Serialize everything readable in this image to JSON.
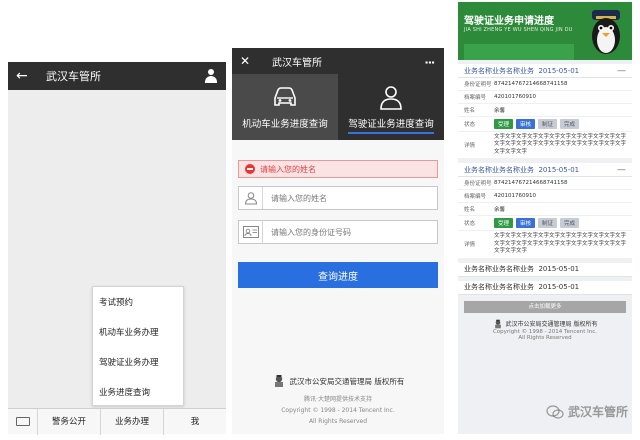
{
  "panel1": {
    "title": "武汉车管所",
    "back_icon": "back-arrow-icon",
    "user_icon": "person-icon",
    "menu": [
      "考试预约",
      "机动车业务办理",
      "驾驶证业务办理",
      "业务进度查询"
    ],
    "bottom_tabs": [
      "警务公开",
      "业务办理",
      "我"
    ]
  },
  "panel2": {
    "title": "武汉车管所",
    "close_glyph": "✕",
    "more_glyph": "•••",
    "tabs": [
      {
        "label": "机动车业务进度查询",
        "icon": "car-icon"
      },
      {
        "label": "驾驶证业务进度查询",
        "icon": "person-outline-icon"
      }
    ],
    "error": "请输入您的姓名",
    "name_placeholder": "请输入您的姓名",
    "id_placeholder": "请输入您的身份证号码",
    "submit": "查询进度",
    "footer": {
      "org": "武汉市公安局交通管理局 版权所有",
      "line1": "腾讯·大楚网提供技术支持",
      "line2": "Copyright © 1998 - 2014 Tencent Inc.",
      "line3": "All Rights Reserved"
    }
  },
  "panel3": {
    "banner_title": "驾驶证业务申请进度",
    "banner_sub": "JIA SHI ZHENG YE WU SHEN QING JIN DU",
    "cards": [
      {
        "title": "业务名称业务名称业务",
        "date": "2015-05-01",
        "id_label": "身份证明号",
        "id_value": "874214767214668741158",
        "file_label": "档案编号",
        "file_value": "420101760910",
        "name_label": "姓名",
        "name_value": "余馨",
        "status_label": "状态",
        "steps": [
          "受理",
          "审核",
          "制证",
          "完成"
        ],
        "detail_label": "详情",
        "detail_value": "文字文字文字文字文字文字文字文字文字文字文字文字文字文字文字文字文字文字文字文字文字文字文字文字文字文字文字"
      },
      {
        "title": "业务名称业务名称业务",
        "date": "2015-05-01",
        "id_label": "身份证明号",
        "id_value": "874214767214668741158",
        "file_label": "档案编号",
        "file_value": "420101760910",
        "name_label": "姓名",
        "name_value": "余馨",
        "status_label": "状态",
        "steps": [
          "受理",
          "审核",
          "制证",
          "完成"
        ],
        "detail_label": "详情",
        "detail_value": "文字文字文字文字文字文字文字文字文字文字文字文字文字文字文字文字文字文字文字文字文字文字文字文字文字文字文字"
      }
    ],
    "collapsed": [
      {
        "title": "业务名称业务名称业务",
        "date": "2015-05-01"
      },
      {
        "title": "业务名称业务名称业务",
        "date": "2015-05-01"
      }
    ],
    "load_more": "点击加载更多",
    "footer": {
      "org": "武汉市公安局交通管理局 版权所有",
      "line1": "Copyright © 1998 - 2014 Tencent Inc.",
      "line2": "All Rights Reserved"
    },
    "watermark": "武汉车管所"
  }
}
